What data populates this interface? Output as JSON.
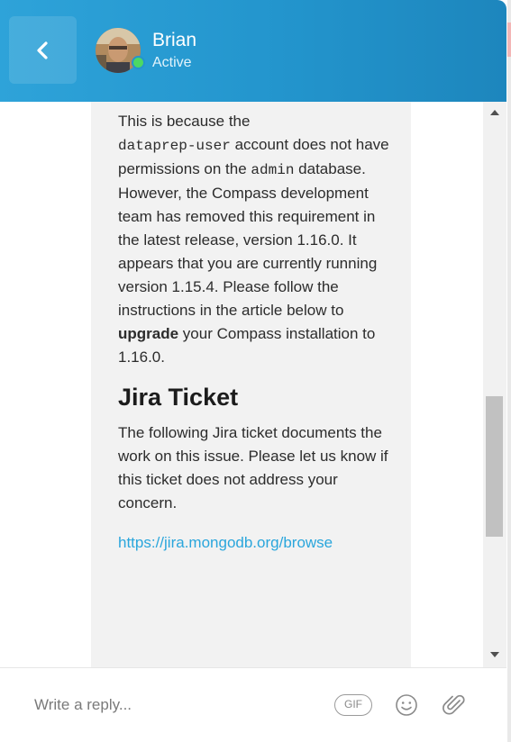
{
  "header": {
    "agent_name": "Brian",
    "agent_status": "Active"
  },
  "message": {
    "p1": {
      "t1": "This is because the",
      "code1": "dataprep-user",
      "t2": "account does not have permissions on the",
      "code2": "admin",
      "t3": "database. However, the Compass development team has removed this requirement in the latest release, version 1.16.0.  It appears that you are currently running version 1.15.4.  Please follow the instructions in the article below to",
      "bold": "upgrade",
      "t4": "your Compass installation to 1.16.0."
    },
    "heading": "Jira Ticket",
    "p2": "The following Jira ticket documents the work on this issue.  Please let us know if this ticket does not address your concern.",
    "link": "https://jira.mongodb.org/browse"
  },
  "composer": {
    "placeholder": "Write a reply...",
    "gif_label": "GIF"
  },
  "icons": {
    "back": "chevron-left-icon",
    "emoji": "smiley-icon",
    "attach": "paperclip-icon"
  },
  "colors": {
    "header": "#2395cd",
    "presence": "#4cd964",
    "link": "#2aa6dc",
    "bubble": "#f2f2f2"
  }
}
